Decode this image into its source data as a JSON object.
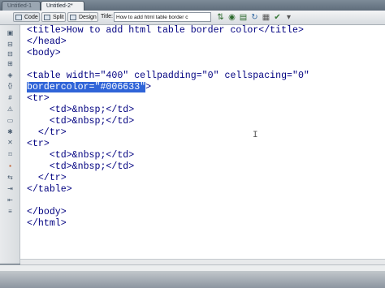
{
  "tabs": [
    {
      "label": "Untitled-1"
    },
    {
      "label": "Untitled-2*"
    }
  ],
  "toolbar": {
    "code_label": "Code",
    "split_label": "Split",
    "design_label": "Design",
    "title_label": "Title:",
    "title_value": "How to add html table border c",
    "icons": [
      "file-management-icon",
      "preview-icon",
      "refresh-icon",
      "view-options-icon",
      "visual-aids-icon",
      "validate-icon",
      "check-page-icon"
    ]
  },
  "gutter_icons": [
    "open-documents-icon",
    "collapse-tag-icon",
    "collapse-selection-icon",
    "expand-all-icon",
    "select-parent-tag-icon",
    "balance-braces-icon",
    "line-numbers-icon",
    "highlight-invalid-code-icon",
    "syntax-coloring-icon",
    "apply-comment-icon",
    "remove-comment-icon",
    "wrap-tag-icon",
    "recent-snippets-icon",
    "move-css-icon",
    "indent-code-icon",
    "outdent-code-icon",
    "format-source-icon"
  ],
  "code": {
    "line1": "<title>How to add html table border color</title>",
    "line2": "</head>",
    "line3": "<body>",
    "line4": "",
    "line5": "<table width=\"400\" cellpadding=\"0\" cellspacing=\"0\"",
    "line6_selected": "bordercolor=\"#006633\"",
    "line6_rest": ">",
    "line7": "<tr>",
    "line8": "    <td>&nbsp;</td>",
    "line9": "    <td>&nbsp;</td>",
    "line10": "  </tr>",
    "line11": "<tr>",
    "line12": "    <td>&nbsp;</td>",
    "line13": "    <td>&nbsp;</td>",
    "line14": "  </tr>",
    "line15": "</table>",
    "line16": "",
    "line17": "</body>",
    "line18": "</html>"
  },
  "colors": {
    "code_text": "#000080",
    "selection": "#2f64d8"
  }
}
